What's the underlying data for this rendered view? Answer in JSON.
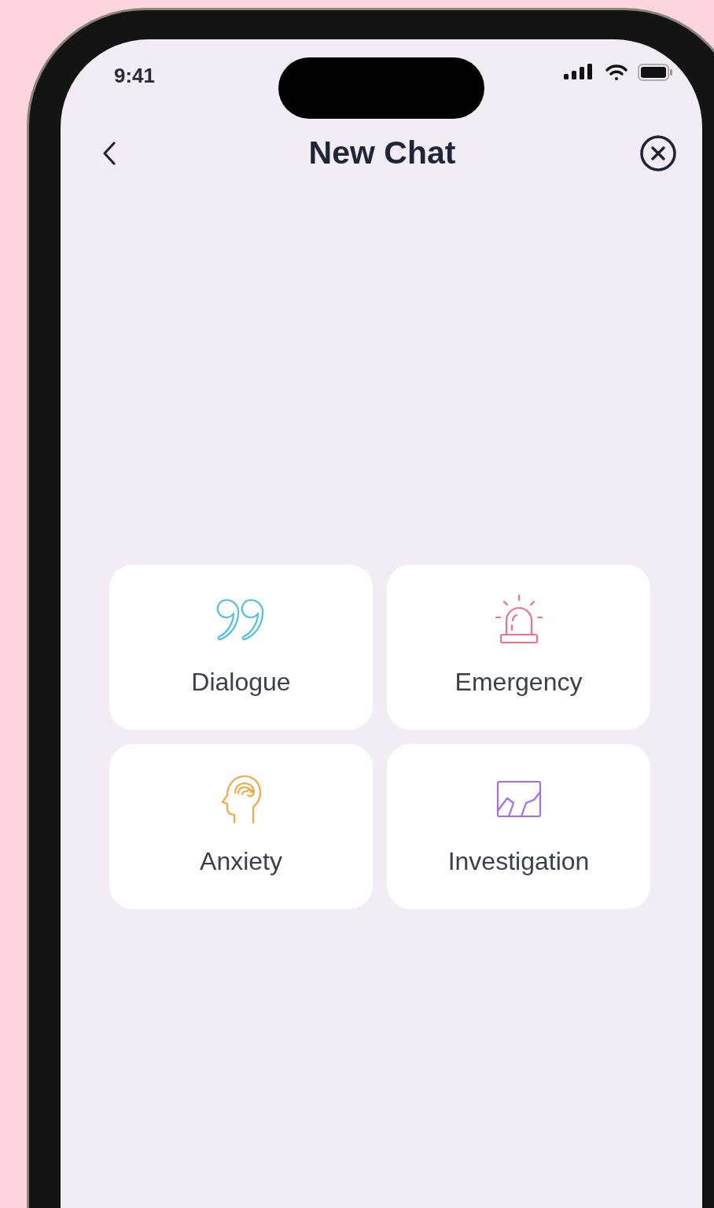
{
  "status_bar": {
    "time": "9:41"
  },
  "header": {
    "title": "New Chat"
  },
  "categories": [
    {
      "label": "Dialogue",
      "kind": "quote",
      "color": "#4cc3dc"
    },
    {
      "label": "Emergency",
      "kind": "siren",
      "color": "#f27089"
    },
    {
      "label": "Anxiety",
      "kind": "head",
      "color": "#f8a640"
    },
    {
      "label": "Investigation",
      "kind": "chart",
      "color": "#a46cf0"
    }
  ]
}
